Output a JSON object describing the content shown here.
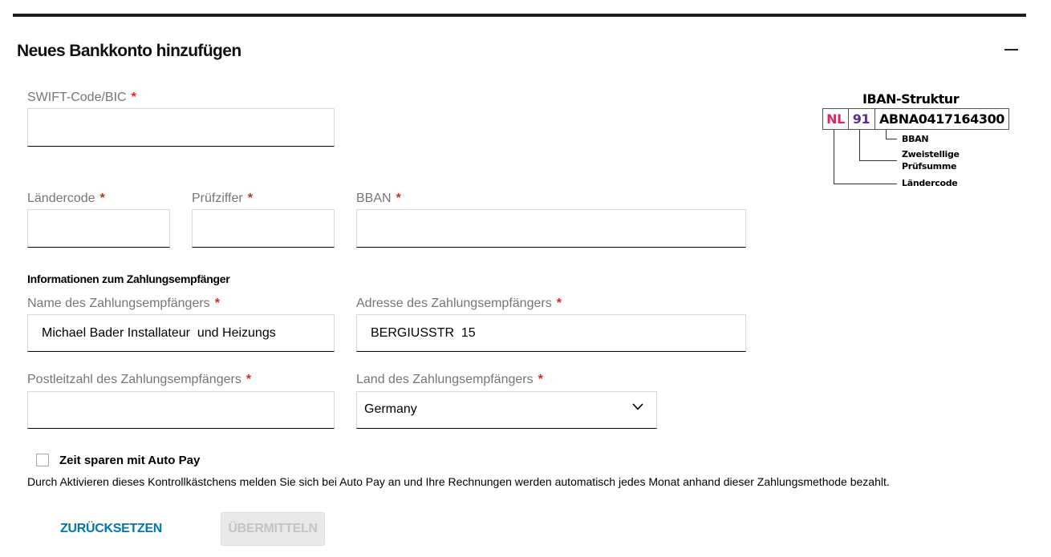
{
  "form": {
    "title": "Neues Bankkonto hinzufügen",
    "required_mark": "*",
    "swift": {
      "label": "SWIFT-Code/BIC",
      "value": ""
    },
    "laendercode": {
      "label": "Ländercode",
      "value": ""
    },
    "pruefziffer": {
      "label": "Prüfziffer",
      "value": ""
    },
    "bban": {
      "label": "BBAN",
      "value": ""
    },
    "payee_section_title": "Informationen zum Zahlungsempfänger",
    "payee_name": {
      "label": "Name des Zahlungsempfängers",
      "value": "Michael Bader Installateur  und Heizungs"
    },
    "payee_address": {
      "label": "Adresse des Zahlungsempfängers",
      "value": "BERGIUSSTR  15"
    },
    "payee_zip": {
      "label": "Postleitzahl des Zahlungsempfängers",
      "value": ""
    },
    "payee_country": {
      "label": "Land des Zahlungsempfängers",
      "value": "Germany"
    },
    "autopay": {
      "label": "Zeit sparen mit Auto Pay",
      "checked": false,
      "description": "Durch Aktivieren dieses Kontrollkästchens melden Sie sich bei Auto Pay an und Ihre Rechnungen werden automatisch jedes Monat anhand dieser Zahlungsmethode bezahlt."
    },
    "buttons": {
      "reset": "ZURÜCKSETZEN",
      "submit": "ÜBERMITTELN"
    }
  },
  "iban_diagram": {
    "title": "IBAN-Struktur",
    "country": "NL",
    "check": "91",
    "bban": "ABNA0417164300",
    "notes": {
      "bban": "BBAN",
      "check_line1": "Zweistellige",
      "check_line2": "Prüfsumme",
      "country": "Ländercode"
    }
  },
  "colors": {
    "required": "#d52b1e",
    "link": "#0077b4",
    "iban_country": "#e0245e",
    "iban_check": "#5b2a9b"
  }
}
